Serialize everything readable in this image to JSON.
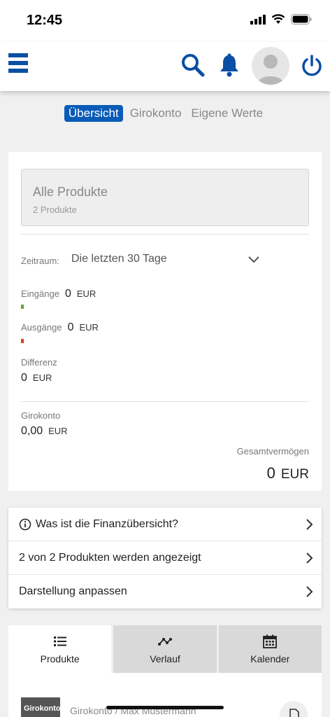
{
  "status": {
    "time": "12:45"
  },
  "tabs": [
    {
      "label": "Übersicht",
      "active": true
    },
    {
      "label": "Girokonto",
      "active": false
    },
    {
      "label": "Eigene Werte",
      "active": false
    }
  ],
  "summary": {
    "products_title": "Alle Produkte",
    "products_count": "2 Produkte",
    "zeitraum_label": "Zeitraum:",
    "zeitraum_value": "Die letzten 30 Tage",
    "eingaenge_label": "Eingänge",
    "eingaenge_value": "0",
    "eingaenge_unit": "EUR",
    "ausgaenge_label": "Ausgänge",
    "ausgaenge_value": "0",
    "ausgaenge_unit": "EUR",
    "differenz_label": "Differenz",
    "differenz_value": "0",
    "differenz_unit": "EUR",
    "girokonto_label": "Girokonto",
    "girokonto_value": "0,00",
    "girokonto_unit": "EUR",
    "gesamt_label": "Gesamtvermögen",
    "gesamt_value": "0",
    "gesamt_unit": "EUR"
  },
  "info_list": [
    {
      "label": "Was ist die Finanzübersicht?"
    },
    {
      "label": "2 von 2 Produkten werden angezeigt"
    },
    {
      "label": "Darstellung anpassen"
    }
  ],
  "view_tabs": [
    {
      "label": "Produkte",
      "icon": "list-icon",
      "active": true
    },
    {
      "label": "Verlauf",
      "icon": "chart-line-icon",
      "active": false
    },
    {
      "label": "Kalender",
      "icon": "calendar-icon",
      "active": false
    }
  ],
  "product_item": {
    "thumb_label": "Girokonto",
    "line": "Girokonto / Max Mustermann"
  },
  "colors": {
    "brand": "#0a4fa3",
    "active_tab": "#0a5bb8",
    "income": "#5aa832",
    "expense": "#e0401e"
  }
}
